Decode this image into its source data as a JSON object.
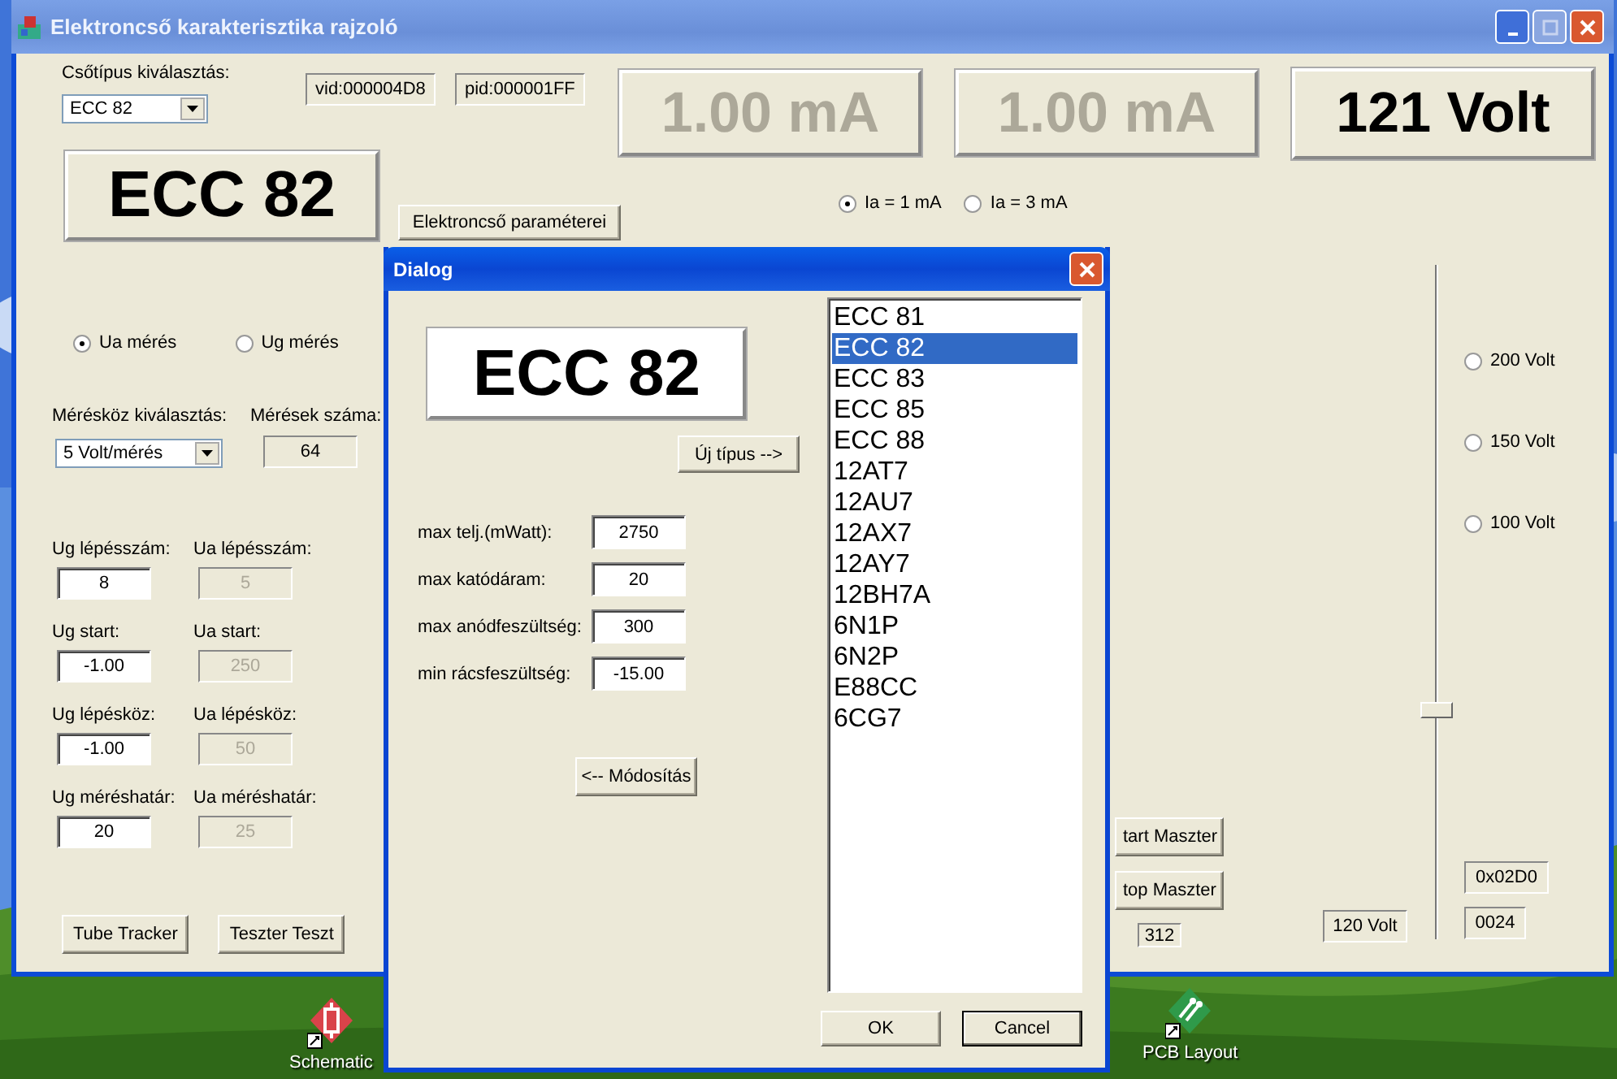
{
  "window": {
    "title": "Elektroncső karakterisztika rajzoló"
  },
  "tube_select": {
    "label": "Csőtípus kiválasztás:",
    "value": "ECC 82"
  },
  "ids": [
    "vid:000004D8",
    "pid:000001FF"
  ],
  "displays": [
    {
      "text": "1.00 mA",
      "disabled": true
    },
    {
      "text": "1.00 mA",
      "disabled": true
    },
    {
      "text": "121 Volt",
      "disabled": false
    }
  ],
  "tube_display": "ECC 82",
  "params_button": "Elektroncső paraméterei",
  "current_radios": [
    {
      "label": "Ia = 1 mA",
      "selected": true
    },
    {
      "label": "Ia = 3 mA",
      "selected": false
    }
  ],
  "mode_radios": [
    {
      "label": "Ua mérés",
      "selected": true
    },
    {
      "label": "Ug mérés",
      "selected": false
    }
  ],
  "step_select": {
    "label": "Mérésköz kiválasztás:",
    "value": "5 Volt/mérés"
  },
  "count": {
    "label": "Mérések száma:",
    "value": "64"
  },
  "fields": [
    {
      "label": "Ug lépésszám:",
      "value": "8",
      "disabled": false
    },
    {
      "label": "Ua lépésszám:",
      "value": "5",
      "disabled": true
    },
    {
      "label": "Ug start:",
      "value": "-1.00",
      "disabled": false
    },
    {
      "label": "Ua start:",
      "value": "250",
      "disabled": true
    },
    {
      "label": "Ug lépésköz:",
      "value": "-1.00",
      "disabled": false
    },
    {
      "label": "Ua lépésköz:",
      "value": "50",
      "disabled": true
    },
    {
      "label": "Ug méréshatár:",
      "value": "20",
      "disabled": false
    },
    {
      "label": "Ua méréshatár:",
      "value": "25",
      "disabled": true
    }
  ],
  "buttons": [
    "Tube Tracker",
    "Teszter Teszt"
  ],
  "master_buttons": [
    "tart Maszter",
    "top Maszter"
  ],
  "counter": "312",
  "voltage_readout": "120 Volt",
  "slider": {
    "level": 0.34
  },
  "voltage_radios": [
    {
      "label": "200 Volt",
      "selected": false
    },
    {
      "label": "150 Volt",
      "selected": false
    },
    {
      "label": "100 Volt",
      "selected": false
    }
  ],
  "hex_readouts": [
    "0x02D0",
    "0024"
  ],
  "dialog": {
    "title": "Dialog",
    "display": "ECC 82",
    "new_type_button": "Új típus -->",
    "fields": [
      {
        "label": "max telj.(mWatt):",
        "value": "2750"
      },
      {
        "label": "max katódáram:",
        "value": "20"
      },
      {
        "label": "max anódfeszültség:",
        "value": "300"
      },
      {
        "label": "min rácsfeszültség:",
        "value": "-15.00"
      }
    ],
    "modify_button": "<-- Módosítás",
    "list": [
      {
        "label": "ECC 81",
        "selected": false
      },
      {
        "label": "ECC 82",
        "selected": true
      },
      {
        "label": "ECC 83",
        "selected": false
      },
      {
        "label": "ECC 85",
        "selected": false
      },
      {
        "label": "ECC 88",
        "selected": false
      },
      {
        "label": "12AT7",
        "selected": false
      },
      {
        "label": "12AU7",
        "selected": false
      },
      {
        "label": "12AX7",
        "selected": false
      },
      {
        "label": "12AY7",
        "selected": false
      },
      {
        "label": "12BH7A",
        "selected": false
      },
      {
        "label": "6N1P",
        "selected": false
      },
      {
        "label": "6N2P",
        "selected": false
      },
      {
        "label": "E88CC",
        "selected": false
      },
      {
        "label": "6CG7",
        "selected": false
      }
    ],
    "buttons": [
      {
        "label": "OK",
        "default": false
      },
      {
        "label": "Cancel",
        "default": true
      }
    ]
  },
  "desktop_icons": [
    {
      "label": "Schematic",
      "kind": "schematic"
    },
    {
      "label": "PCB Layout",
      "kind": "pcb"
    }
  ]
}
